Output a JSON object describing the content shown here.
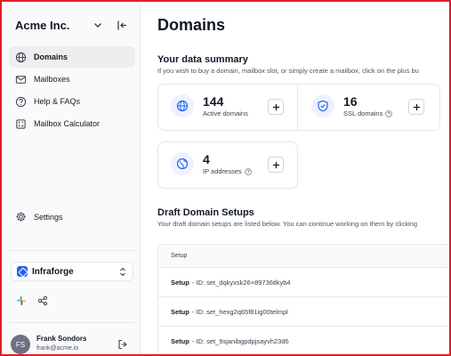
{
  "sidebar": {
    "brand": "Acme Inc.",
    "nav": [
      {
        "label": "Domains",
        "icon": "globe-icon",
        "active": true
      },
      {
        "label": "Mailboxes",
        "icon": "mail-icon"
      },
      {
        "label": "Help & FAQs",
        "icon": "help-icon"
      },
      {
        "label": "Mailbox Calculator",
        "icon": "calculator-icon"
      }
    ],
    "settings_label": "Settings",
    "workspace": "Infraforge",
    "user": {
      "initials": "FS",
      "name": "Frank Sondors",
      "email": "frank@acme.io"
    }
  },
  "main": {
    "title": "Domains",
    "summary": {
      "title": "Your data summary",
      "description": "If you wish to buy a domain, mailbox slot, or simply create a mailbox, click on the plus bu",
      "stats": [
        {
          "value": "144",
          "label": "Active domains",
          "icon": "globe-icon"
        },
        {
          "value": "16",
          "label": "SSL domains",
          "icon": "shield-check-icon"
        },
        {
          "value": "4",
          "label": "IP addresses",
          "icon": "network-globe-icon"
        }
      ]
    },
    "drafts": {
      "title": "Draft Domain Setups",
      "description": "Your draft domain setups are listed below. You can continue working on them by clicking",
      "column_header": "Setup",
      "rows": [
        {
          "label": "Setup",
          "rest": "- ID: set_dqkyxsk26×89736tlkyb4"
        },
        {
          "label": "Setup",
          "rest": "- ID: set_hexg2q65f81ig00telmpl"
        },
        {
          "label": "Setup",
          "rest": "- ID: set_9sjanibgpdpjsayvh23d6"
        }
      ]
    }
  },
  "colors": {
    "accent": "#2563eb",
    "frame": "#e11d2a",
    "icon_bg": "#eef2ff"
  }
}
